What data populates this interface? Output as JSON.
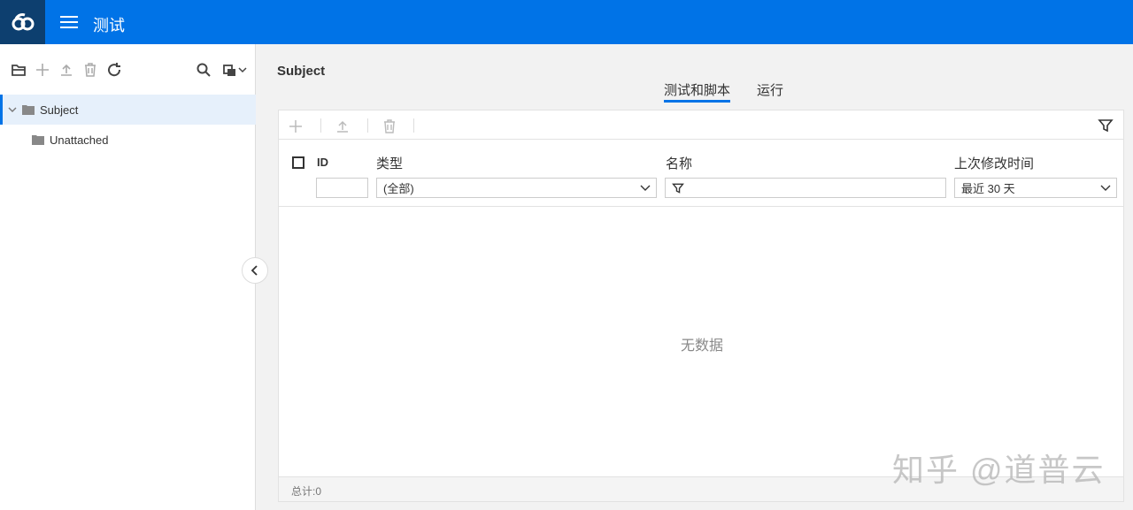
{
  "app": {
    "title": "测试"
  },
  "tree_toolbar": {
    "icons": [
      "new-folder-icon",
      "add-icon",
      "upload-icon",
      "delete-icon",
      "refresh-icon",
      "search-icon",
      "copy-dropdown-icon"
    ]
  },
  "tree": {
    "items": [
      {
        "label": "Subject",
        "selected": true,
        "expanded": true
      },
      {
        "label": "Unattached",
        "selected": false
      }
    ]
  },
  "main": {
    "breadcrumb_title": "Subject",
    "tabs": [
      {
        "label": "测试和脚本",
        "active": true
      },
      {
        "label": "运行",
        "active": false
      }
    ],
    "grid_toolbar": {
      "icons": [
        "add-icon",
        "upload-icon",
        "delete-icon",
        "filter-icon"
      ]
    },
    "columns": [
      {
        "label": "ID",
        "filter_value": ""
      },
      {
        "label": "类型",
        "filter_value": "(全部)"
      },
      {
        "label": "名称",
        "filter_value": ""
      },
      {
        "label": "上次修改时间",
        "filter_value": "最近 30 天"
      }
    ],
    "empty_text": "无数据",
    "footer_total": "总计:0"
  },
  "watermark": "知乎 @道普云",
  "colors": {
    "accent": "#0073e7",
    "logo_bg": "#0d3f6f"
  }
}
